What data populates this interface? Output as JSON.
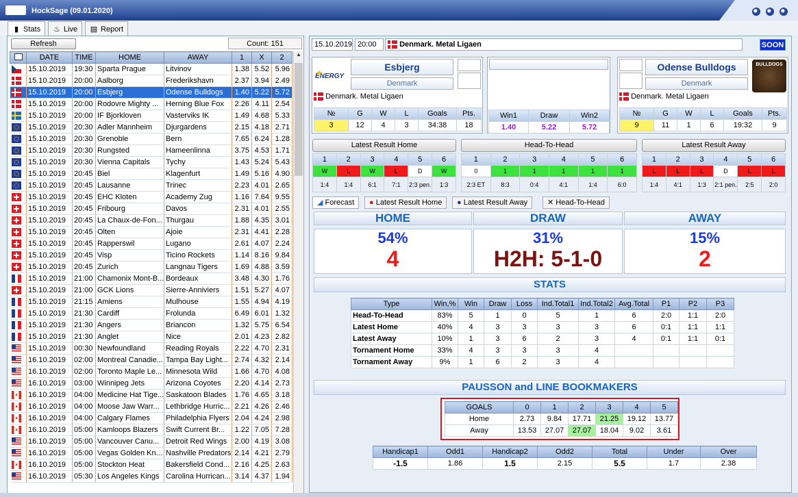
{
  "window": {
    "title": "HockSage (09.01.2020)"
  },
  "tabs": [
    {
      "label": "Stats",
      "icon": "bar-chart-icon"
    },
    {
      "label": "Live",
      "icon": "flame-icon"
    },
    {
      "label": "Report",
      "icon": "document-icon"
    }
  ],
  "left": {
    "refresh_label": "Refresh",
    "count_label": "Count: 151",
    "columns": [
      "DATE",
      "TIME",
      "HOME",
      "AWAY",
      "1",
      "X",
      "2"
    ],
    "rows": [
      {
        "flag": "cz",
        "date": "15.10.2019",
        "time": "19:30",
        "home": "Sparta Prague",
        "away": "Litvinov",
        "o1": "1.38",
        "ox": "5.52",
        "o2": "5.96"
      },
      {
        "flag": "dk",
        "date": "15.10.2019",
        "time": "20:00",
        "home": "Aalborg",
        "away": "Frederikshavn",
        "o1": "2.37",
        "ox": "3.94",
        "o2": "2.49"
      },
      {
        "flag": "dk",
        "date": "15.10.2019",
        "time": "20:00",
        "home": "Esbjerg",
        "away": "Odense Bulldogs",
        "o1": "1.40",
        "ox": "5.22",
        "o2": "5.72",
        "selected": true
      },
      {
        "flag": "dk",
        "date": "15.10.2019",
        "time": "20:00",
        "home": "Rodovre Mighty ...",
        "away": "Herning Blue Fox",
        "o1": "2.26",
        "ox": "4.11",
        "o2": "2.54"
      },
      {
        "flag": "se",
        "date": "15.10.2019",
        "time": "20:00",
        "home": "IF Bjorkloven",
        "away": "Vasterviks IK",
        "o1": "1.49",
        "ox": "4.68",
        "o2": "5.33"
      },
      {
        "flag": "eu",
        "date": "15.10.2019",
        "time": "20:30",
        "home": "Adler Mannheim",
        "away": "Djurgardens",
        "o1": "2.15",
        "ox": "4.18",
        "o2": "2.71"
      },
      {
        "flag": "eu",
        "date": "15.10.2019",
        "time": "20:30",
        "home": "Grenoble",
        "away": "Bern",
        "o1": "7.65",
        "ox": "6.24",
        "o2": "1.28"
      },
      {
        "flag": "eu",
        "date": "15.10.2019",
        "time": "20:30",
        "home": "Rungsted",
        "away": "Hameenlinna",
        "o1": "3.75",
        "ox": "4.53",
        "o2": "1.71"
      },
      {
        "flag": "eu",
        "date": "15.10.2019",
        "time": "20:30",
        "home": "Vienna Capitals",
        "away": "Tychy",
        "o1": "1.43",
        "ox": "5.24",
        "o2": "5.43"
      },
      {
        "flag": "eu",
        "date": "15.10.2019",
        "time": "20:45",
        "home": "Biel",
        "away": "Klagenfurt",
        "o1": "1.49",
        "ox": "5.16",
        "o2": "4.90"
      },
      {
        "flag": "eu",
        "date": "15.10.2019",
        "time": "20:45",
        "home": "Lausanne",
        "away": "Trinec",
        "o1": "2.23",
        "ox": "4.01",
        "o2": "2.65"
      },
      {
        "flag": "ch",
        "date": "15.10.2019",
        "time": "20:45",
        "home": "EHC Kloten",
        "away": "Academy Zug",
        "o1": "1.16",
        "ox": "7.64",
        "o2": "9.55"
      },
      {
        "flag": "ch",
        "date": "15.10.2019",
        "time": "20:45",
        "home": "Fribourg",
        "away": "Davos",
        "o1": "2.31",
        "ox": "4.01",
        "o2": "2.55"
      },
      {
        "flag": "ch",
        "date": "15.10.2019",
        "time": "20:45",
        "home": "La Chaux-de-Fon...",
        "away": "Thurgau",
        "o1": "1.88",
        "ox": "4.35",
        "o2": "3.01"
      },
      {
        "flag": "ch",
        "date": "15.10.2019",
        "time": "20:45",
        "home": "Olten",
        "away": "Ajoie",
        "o1": "2.31",
        "ox": "4.41",
        "o2": "2.28"
      },
      {
        "flag": "ch",
        "date": "15.10.2019",
        "time": "20:45",
        "home": "Rapperswil",
        "away": "Lugano",
        "o1": "2.61",
        "ox": "4.07",
        "o2": "2.24"
      },
      {
        "flag": "ch",
        "date": "15.10.2019",
        "time": "20:45",
        "home": "Visp",
        "away": "Ticino Rockets",
        "o1": "1.14",
        "ox": "8.16",
        "o2": "9.84"
      },
      {
        "flag": "ch",
        "date": "15.10.2019",
        "time": "20:45",
        "home": "Zurich",
        "away": "Langnau Tigers",
        "o1": "1.69",
        "ox": "4.88",
        "o2": "3.59"
      },
      {
        "flag": "fr",
        "date": "15.10.2019",
        "time": "21:00",
        "home": "Chamonix Mont-B...",
        "away": "Bordeaux",
        "o1": "3.48",
        "ox": "4.30",
        "o2": "1.76"
      },
      {
        "flag": "ch",
        "date": "15.10.2019",
        "time": "21:00",
        "home": "GCK Lions",
        "away": "Sierre-Anniviers",
        "o1": "1.51",
        "ox": "5.27",
        "o2": "4.07"
      },
      {
        "flag": "fr",
        "date": "15.10.2019",
        "time": "21:15",
        "home": "Amiens",
        "away": "Mulhouse",
        "o1": "1.55",
        "ox": "4.94",
        "o2": "4.19"
      },
      {
        "flag": "fr",
        "date": "15.10.2019",
        "time": "21:30",
        "home": "Cardiff",
        "away": "Frolunda",
        "o1": "6.49",
        "ox": "6.01",
        "o2": "1.32"
      },
      {
        "flag": "fr",
        "date": "15.10.2019",
        "time": "21:30",
        "home": "Angers",
        "away": "Briancon",
        "o1": "1.32",
        "ox": "5.75",
        "o2": "6.54"
      },
      {
        "flag": "fr",
        "date": "15.10.2019",
        "time": "21:30",
        "home": "Anglet",
        "away": "Nice",
        "o1": "2.01",
        "ox": "4.23",
        "o2": "2.82"
      },
      {
        "flag": "us",
        "date": "15.10.2019",
        "time": "00:30",
        "home": "Newfoundland",
        "away": "Reading Royals",
        "o1": "2.22",
        "ox": "4.70",
        "o2": "2.31"
      },
      {
        "flag": "us",
        "date": "16.10.2019",
        "time": "02:00",
        "home": "Montreal Canadie...",
        "away": "Tampa Bay Light...",
        "o1": "2.74",
        "ox": "4.32",
        "o2": "2.14"
      },
      {
        "flag": "us",
        "date": "16.10.2019",
        "time": "02:00",
        "home": "Toronto Maple Le...",
        "away": "Minnesota Wild",
        "o1": "1.66",
        "ox": "4.70",
        "o2": "4.08"
      },
      {
        "flag": "us",
        "date": "16.10.2019",
        "time": "03:00",
        "home": "Winnipeg Jets",
        "away": "Arizona Coyotes",
        "o1": "2.20",
        "ox": "4.14",
        "o2": "2.73"
      },
      {
        "flag": "ca",
        "date": "16.10.2019",
        "time": "04:00",
        "home": "Medicine Hat Tige...",
        "away": "Saskatoon Blades",
        "o1": "1.76",
        "ox": "4.65",
        "o2": "3.18"
      },
      {
        "flag": "ca",
        "date": "16.10.2019",
        "time": "04:00",
        "home": "Moose Jaw Warr...",
        "away": "Lethbridge Hurric...",
        "o1": "2.21",
        "ox": "4.26",
        "o2": "2.46"
      },
      {
        "flag": "ca",
        "date": "16.10.2019",
        "time": "04:00",
        "home": "Calgary Flames",
        "away": "Philadelphia Flyers",
        "o1": "2.04",
        "ox": "4.24",
        "o2": "2.98"
      },
      {
        "flag": "ca",
        "date": "16.10.2019",
        "time": "05:00",
        "home": "Kamloops Blazers",
        "away": "Swift Current Br...",
        "o1": "1.22",
        "ox": "7.05",
        "o2": "7.28"
      },
      {
        "flag": "us",
        "date": "16.10.2019",
        "time": "05:00",
        "home": "Vancouver Canu...",
        "away": "Detroit Red Wings",
        "o1": "2.00",
        "ox": "4.19",
        "o2": "3.08"
      },
      {
        "flag": "us",
        "date": "16.10.2019",
        "time": "05:00",
        "home": "Vegas Golden Kn...",
        "away": "Nashville Predators",
        "o1": "2.14",
        "ox": "4.21",
        "o2": "2.79"
      },
      {
        "flag": "ca",
        "date": "16.10.2019",
        "time": "05:00",
        "home": "Stockton Heat",
        "away": "Bakersfield Cond...",
        "o1": "2.16",
        "ox": "4.25",
        "o2": "2.63"
      },
      {
        "flag": "us",
        "date": "16.10.2019",
        "time": "05:30",
        "home": "Los Angeles Kings",
        "away": "Carolina Hurrican...",
        "o1": "3.14",
        "ox": "4.37",
        "o2": "1.94"
      }
    ]
  },
  "match": {
    "date": "15.10.2019",
    "time": "20:00",
    "league": "Denmark. Metal Ligaen",
    "status": "SOON",
    "home": {
      "name": "Esbjerg",
      "country": "Denmark",
      "league": "Denmark. Metal Ligaen",
      "rank": "3",
      "g": "12",
      "w": "4",
      "l": "3",
      "goals": "34:38",
      "pts": "18",
      "logo_text": "ENERGY"
    },
    "away": {
      "name": "Odense Bulldogs",
      "country": "Denmark",
      "league": "Denmark. Metal Ligaen",
      "rank": "9",
      "g": "11",
      "w": "1",
      "l": "6",
      "goals": "19:32",
      "pts": "9",
      "logo_text": "BULLDOGS"
    },
    "team_cols": [
      "№",
      "G",
      "W",
      "L",
      "Goals",
      "Pts."
    ],
    "odds_cols": [
      "Win1",
      "Draw",
      "Win2"
    ],
    "odds": [
      "1.40",
      "5.22",
      "5.72"
    ]
  },
  "results": {
    "home_title": "Latest Result Home",
    "h2h_title": "Head-To-Head",
    "away_title": "Latest Result Away",
    "nums": [
      "1",
      "2",
      "3",
      "4",
      "5",
      "6"
    ],
    "home_res": [
      {
        "r": "W",
        "c": "g"
      },
      {
        "r": "L",
        "c": "r"
      },
      {
        "r": "W",
        "c": "g"
      },
      {
        "r": "L",
        "c": "r"
      },
      {
        "r": "D",
        "c": "w"
      },
      {
        "r": "W",
        "c": "g"
      }
    ],
    "home_scores": [
      "1:4",
      "1:4",
      "6:1",
      "7:1",
      "2:3 pen.",
      "1:3"
    ],
    "h2h_res": [
      {
        "r": "0",
        "c": "w"
      },
      {
        "r": "1",
        "c": "g"
      },
      {
        "r": "1",
        "c": "g"
      },
      {
        "r": "1",
        "c": "g"
      },
      {
        "r": "1",
        "c": "g"
      },
      {
        "r": "1",
        "c": "g"
      }
    ],
    "h2h_scores": [
      "2:3 ET",
      "8:3",
      "0:4",
      "4:1",
      "1:4",
      "6:0"
    ],
    "away_res": [
      {
        "r": "L",
        "c": "r"
      },
      {
        "r": "L",
        "c": "r"
      },
      {
        "r": "L",
        "c": "r"
      },
      {
        "r": "D",
        "c": "w"
      },
      {
        "r": "L",
        "c": "r"
      },
      {
        "r": "L",
        "c": "r"
      }
    ],
    "away_scores": [
      "1:4",
      "4:1",
      "1:3",
      "2:1 pen.",
      "2:5",
      "2:0"
    ]
  },
  "subtabs": [
    "Forecast",
    "Latest Result Home",
    "Latest Result  Away",
    "Head-To-Head"
  ],
  "forecast": {
    "home": "HOME",
    "draw": "DRAW",
    "away": "AWAY",
    "home_pct": "54%",
    "draw_pct": "31%",
    "away_pct": "15%",
    "home_goals": "4",
    "h2h": "H2H: 5-1-0",
    "away_goals": "2"
  },
  "stats": {
    "title": "STATS",
    "cols": [
      "Type",
      "Win,%",
      "Win",
      "Draw",
      "Loss",
      "Ind.Total1",
      "Ind.Total2",
      "Avg.Total",
      "P1",
      "P2",
      "P3"
    ],
    "rows": [
      [
        "Head-To-Head",
        "83%",
        "5",
        "1",
        "0",
        "5",
        "1",
        "6",
        "2:0",
        "1:1",
        "2:0"
      ],
      [
        "Latest Home",
        "40%",
        "4",
        "3",
        "3",
        "3",
        "3",
        "6",
        "0:1",
        "1:1",
        "1:1"
      ],
      [
        "Latest Away",
        "10%",
        "1",
        "3",
        "6",
        "2",
        "3",
        "4",
        "0:1",
        "1:1",
        "0:1"
      ],
      [
        "Tornament Home",
        "33%",
        "4",
        "3",
        "3",
        "3",
        "4",
        "",
        "",
        "",
        ""
      ],
      [
        "Tornament Away",
        "9%",
        "1",
        "6",
        "2",
        "3",
        "4",
        "",
        "",
        "",
        ""
      ]
    ]
  },
  "paus": {
    "title": "PAUSSON and LINE BOOKMAKERS",
    "cols": [
      "GOALS",
      "0",
      "1",
      "2",
      "3",
      "4",
      "5"
    ],
    "home": [
      "Home",
      "2.73",
      "9.84",
      "17.71",
      "21.25",
      "19.12",
      "13.77"
    ],
    "away": [
      "Away",
      "13.53",
      "27.07",
      "27.07",
      "18.04",
      "9.02",
      "3.61"
    ]
  },
  "line": {
    "cols": [
      "Handicap1",
      "Odd1",
      "Handicap2",
      "Odd2",
      "Total",
      "Under",
      "Over"
    ],
    "vals": [
      "-1.5",
      "1.86",
      "1.5",
      "2.15",
      "5.5",
      "1.7",
      "2.38"
    ]
  }
}
